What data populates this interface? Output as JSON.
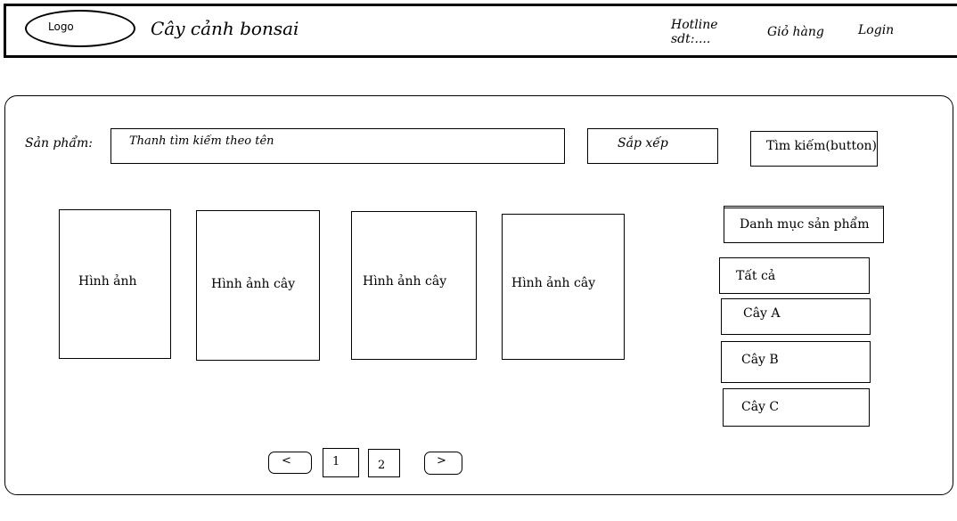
{
  "header": {
    "logo": "Logo",
    "site_title": "Cây cảnh bonsai",
    "hotline_label": "Hotline",
    "hotline_phone": "sdt:....",
    "cart": "Giỏ hàng",
    "login": "Login"
  },
  "search": {
    "label": "Sản phẩm:",
    "placeholder": "Thanh tìm kiếm theo tên",
    "sort": "Sắp xếp",
    "button": "Tìm kiếm(button)"
  },
  "products": [
    {
      "image_label": "Hình ảnh"
    },
    {
      "image_label": "Hình ảnh cây"
    },
    {
      "image_label": "Hình ảnh cây"
    },
    {
      "image_label": "Hình ảnh cây"
    }
  ],
  "categories": {
    "title": "Danh mục sản phẩm",
    "items": [
      "Tất cả",
      "Cây A",
      "Cây B",
      "Cây C"
    ]
  },
  "pagination": {
    "prev": "<",
    "pages": [
      "1",
      "2"
    ],
    "next": ">"
  }
}
